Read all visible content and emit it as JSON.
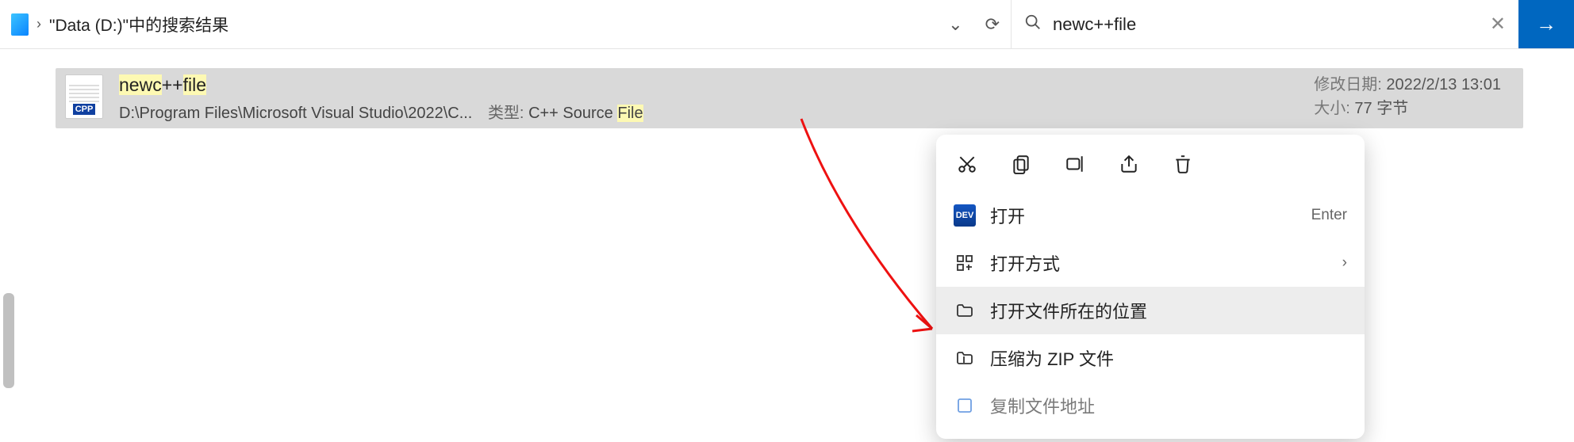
{
  "addr": {
    "text": "\"Data (D:)\"中的搜索结果"
  },
  "search": {
    "value": "newc++file"
  },
  "result": {
    "name_parts": [
      "newc",
      "+",
      "+",
      "file"
    ],
    "path": "D:\\Program Files\\Microsoft Visual Studio\\2022\\C...",
    "type_label": "类型:",
    "type_value_parts": [
      "C++ Source ",
      "File"
    ],
    "date_label": "修改日期:",
    "date_value": "2022/2/13 13:01",
    "size_label": "大小:",
    "size_value": "77 字节",
    "badge": "CPP"
  },
  "ctx": {
    "open": "打开",
    "open_hint": "Enter",
    "open_with": "打开方式",
    "open_location": "打开文件所在的位置",
    "zip": "压缩为 ZIP 文件",
    "copy_path": "复制文件地址"
  }
}
